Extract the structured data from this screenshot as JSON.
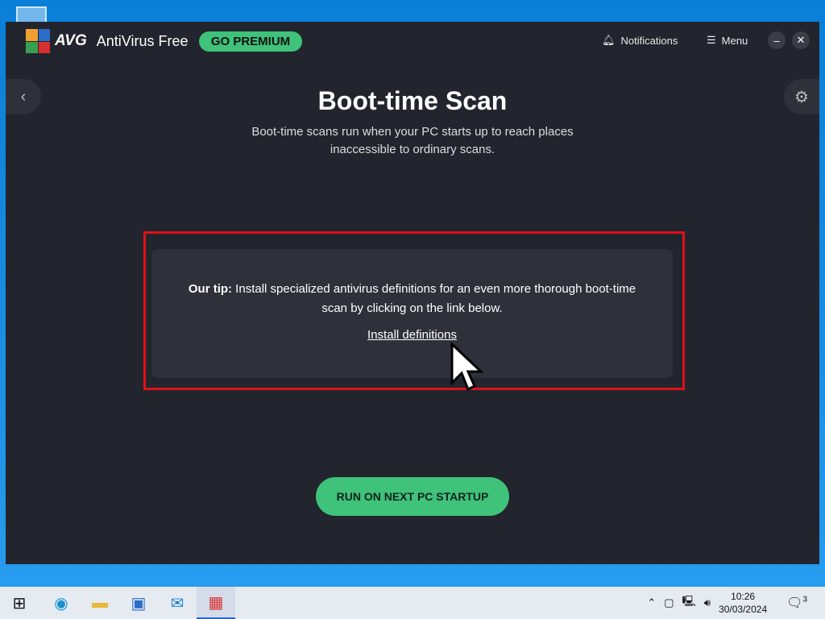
{
  "window": {
    "brand": "AVG",
    "product": "AntiVirus Free",
    "premium": "GO PREMIUM",
    "notifications": "Notifications",
    "menu": "Menu"
  },
  "page": {
    "title": "Boot-time Scan",
    "subtitle": "Boot-time scans run when your PC starts up to reach places inaccessible to ordinary scans.",
    "tip_label": "Our tip:",
    "tip_text": " Install specialized antivirus definitions for an even more thorough boot-time scan by clicking on the link below.",
    "install_link": "Install definitions",
    "run_button": "RUN ON NEXT PC STARTUP"
  },
  "colors": {
    "accent": "#3fc27a",
    "highlight": "#e0101a",
    "background": "#22252d"
  },
  "taskbar": {
    "time": "10:26",
    "date": "30/03/2024",
    "notification_count": "3"
  }
}
